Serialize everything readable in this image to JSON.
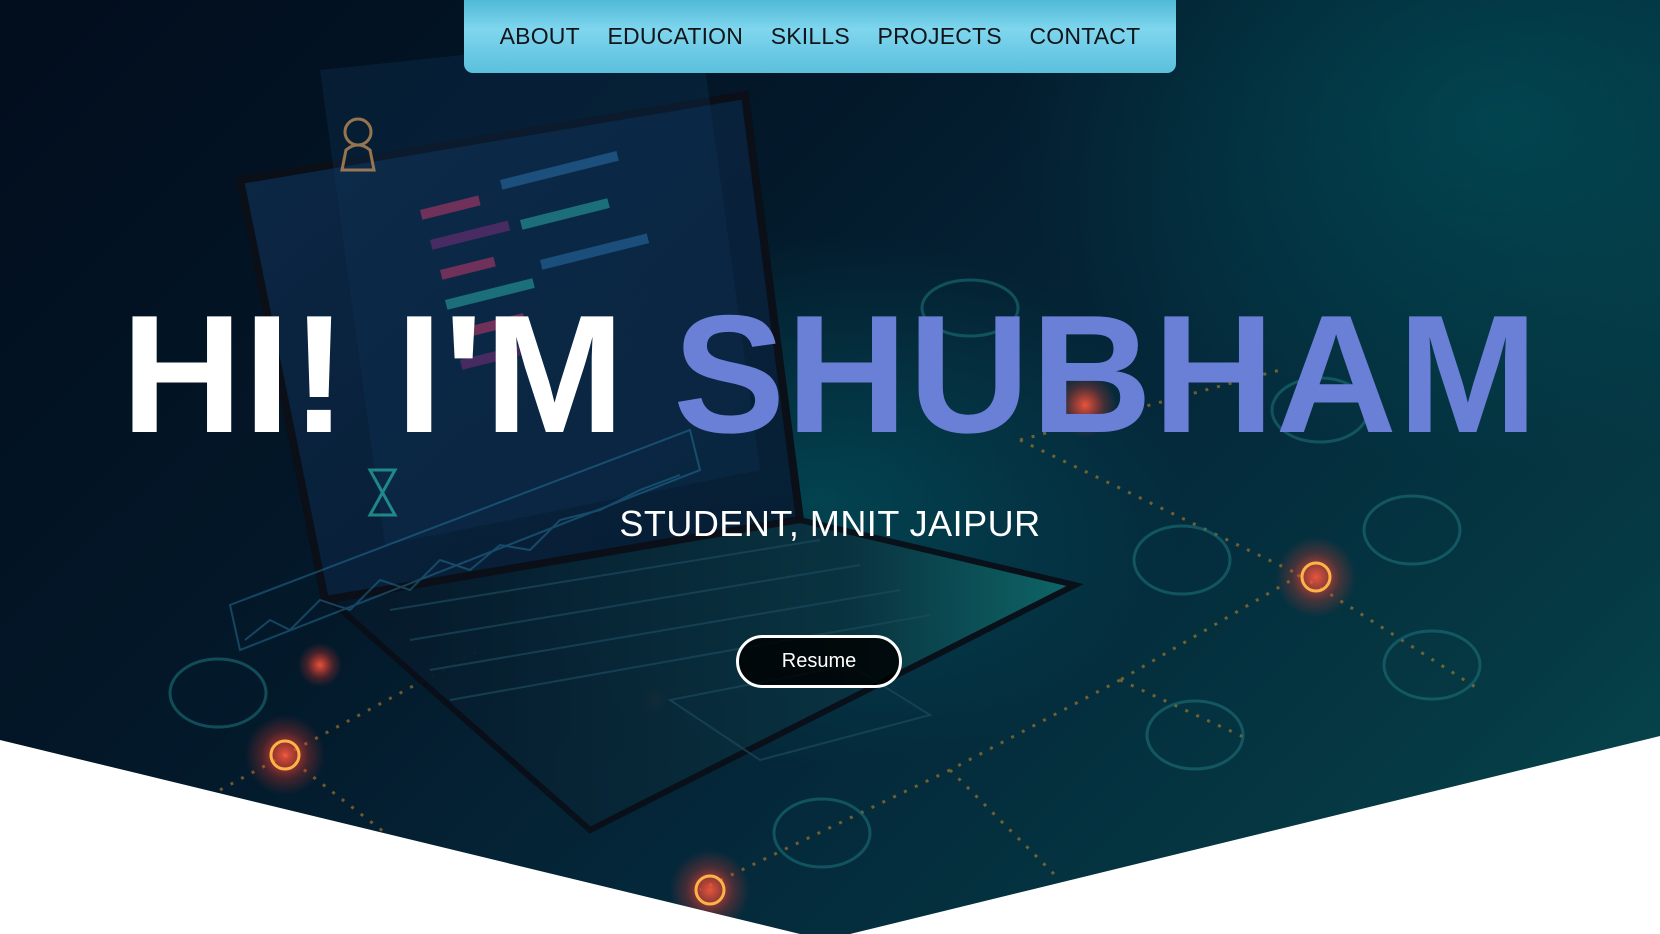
{
  "nav": {
    "items": [
      {
        "label": "ABOUT"
      },
      {
        "label": "EDUCATION"
      },
      {
        "label": "SKILLS"
      },
      {
        "label": "PROJECTS"
      },
      {
        "label": "CONTACT"
      }
    ]
  },
  "hero": {
    "greeting": "HI! I'M",
    "name": "SHUBHAM",
    "subtitle": "STUDENT, MNIT JAIPUR",
    "resume_label": "Resume"
  },
  "colors": {
    "nav_background": "#7fd6ee",
    "name_accent": "#6a7fd6",
    "hero_background": "#031829",
    "text_primary": "#ffffff"
  }
}
